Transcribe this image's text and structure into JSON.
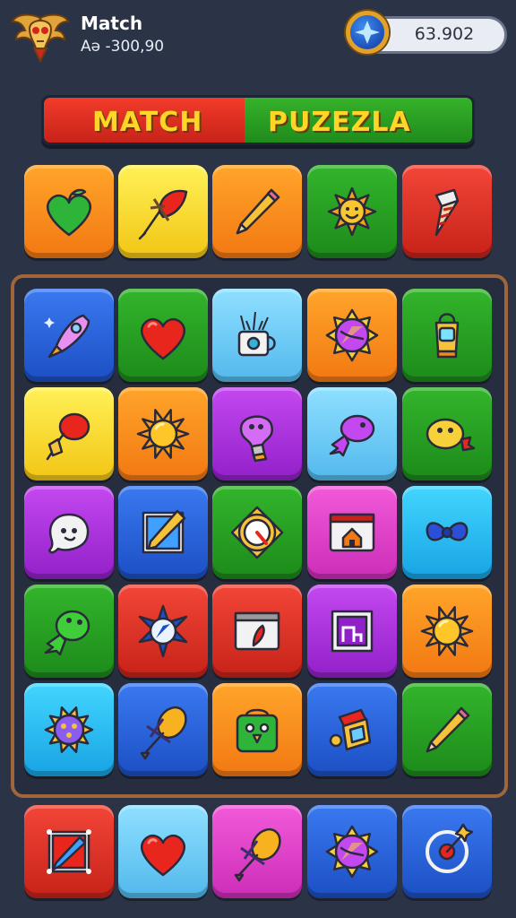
{
  "header": {
    "title": "Match",
    "subtitle": "Aə -300,90",
    "coins": "63.902",
    "logo_icon": "winged-skull-emblem-icon",
    "coin_icon": "blue-gem-coin-icon"
  },
  "banner": {
    "word1": "MATCH",
    "word2": "PUZEZLA",
    "colors": {
      "left": "#e02e22",
      "right": "#2ea526",
      "text": "#ffd627"
    }
  },
  "top_row": [
    {
      "color": "orange",
      "icon": "heart-green"
    },
    {
      "color": "yellow",
      "icon": "brush-red"
    },
    {
      "color": "orange",
      "icon": "pencil"
    },
    {
      "color": "green",
      "icon": "sun-face"
    },
    {
      "color": "red",
      "icon": "drill"
    }
  ],
  "board": [
    [
      {
        "color": "blue",
        "icon": "rocket"
      },
      {
        "color": "green",
        "icon": "heart-red"
      },
      {
        "color": "skyblue",
        "icon": "mug"
      },
      {
        "color": "orange",
        "icon": "compass-sun"
      },
      {
        "color": "green",
        "icon": "lantern"
      }
    ],
    [
      {
        "color": "yellow",
        "icon": "balloon-red"
      },
      {
        "color": "orange",
        "icon": "sun"
      },
      {
        "color": "purple",
        "icon": "lightbulb-purple"
      },
      {
        "color": "skyblue",
        "icon": "fish-purple"
      },
      {
        "color": "green",
        "icon": "chick-yellow"
      }
    ],
    [
      {
        "color": "purple",
        "icon": "ghost"
      },
      {
        "color": "blue",
        "icon": "frame-pencil"
      },
      {
        "color": "green",
        "icon": "gauge"
      },
      {
        "color": "magenta",
        "icon": "window-home"
      },
      {
        "color": "cyan",
        "icon": "bow-blue"
      }
    ],
    [
      {
        "color": "green",
        "icon": "fish-green"
      },
      {
        "color": "red",
        "icon": "compass-star"
      },
      {
        "color": "red",
        "icon": "window-brush"
      },
      {
        "color": "purple",
        "icon": "frame-chart"
      },
      {
        "color": "orange",
        "icon": "sun"
      }
    ],
    [
      {
        "color": "cyan",
        "icon": "virus"
      },
      {
        "color": "blue",
        "icon": "brush-yellow"
      },
      {
        "color": "orange",
        "icon": "bag-face"
      },
      {
        "color": "blue",
        "icon": "lantern-red"
      },
      {
        "color": "green",
        "icon": "pencil"
      }
    ]
  ],
  "bottom_row": [
    {
      "color": "red",
      "icon": "frame-pencil-blue"
    },
    {
      "color": "skyblue",
      "icon": "heart-red"
    },
    {
      "color": "magenta",
      "icon": "brush-yellow"
    },
    {
      "color": "blue",
      "icon": "compass-sun"
    },
    {
      "color": "blue",
      "icon": "gauge-ring"
    }
  ]
}
